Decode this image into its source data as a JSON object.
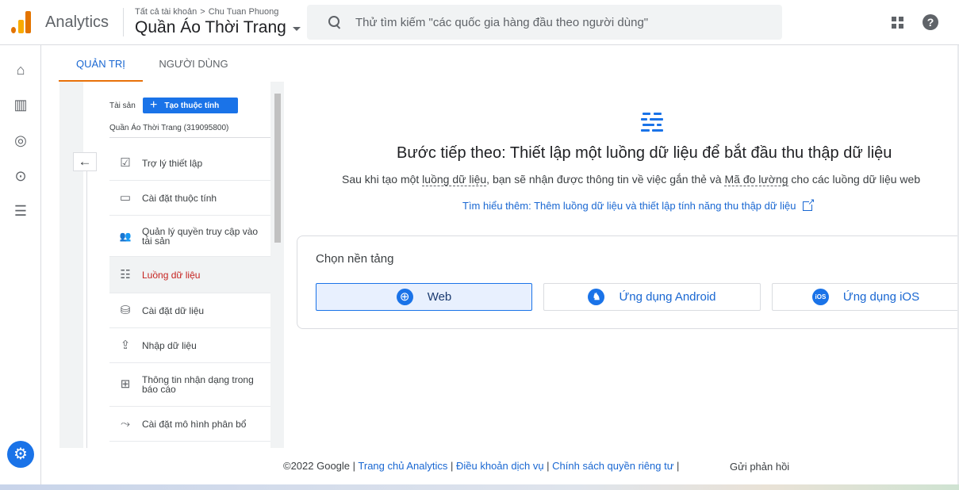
{
  "header": {
    "app_name": "Analytics",
    "breadcrumb": [
      "Tất cả tài khoản",
      "Chu Tuan Phuong"
    ],
    "breadcrumb_separator": ">",
    "property": "Quần Áo Thời Trang",
    "search_placeholder": "Thử tìm kiếm \"các quốc gia hàng đầu theo người dùng\"",
    "apps_icon": "apps-grid-icon",
    "help_icon": "help-icon",
    "help_glyph": "?"
  },
  "rail": {
    "items": [
      {
        "name": "home-icon",
        "glyph": "⌂"
      },
      {
        "name": "reports-icon",
        "glyph": "▥"
      },
      {
        "name": "explore-icon",
        "glyph": "◎"
      },
      {
        "name": "advertising-icon",
        "glyph": "⊙"
      },
      {
        "name": "configure-icon",
        "glyph": "☰"
      }
    ],
    "settings_glyph": "⚙"
  },
  "tabs": {
    "admin": "QUẢN TRỊ",
    "users": "NGƯỜI DÙNG"
  },
  "admin_panel": {
    "asset_label": "Tài sản",
    "create_button": "Tạo thuộc tính",
    "create_plus": "+",
    "back_glyph": "←",
    "property_name": "Quần Áo Thời Trang (319095800)",
    "menu": [
      {
        "label": "Trợ lý thiết lập",
        "glyph": "☑",
        "icon": "setup-assistant-icon"
      },
      {
        "label": "Cài đặt thuộc tính",
        "glyph": "▭",
        "icon": "property-settings-icon"
      },
      {
        "label": "Quản lý quyền truy cập vào tài sản",
        "glyph": "👥",
        "icon": "access-management-icon"
      },
      {
        "label": "Luồng dữ liệu",
        "glyph": "☷",
        "icon": "data-streams-icon",
        "active": true
      },
      {
        "label": "Cài đặt dữ liệu",
        "glyph": "⛁",
        "icon": "data-settings-icon"
      },
      {
        "label": "Nhập dữ liệu",
        "glyph": "⇪",
        "icon": "data-import-icon"
      },
      {
        "label": "Thông tin nhận dạng trong báo cáo",
        "glyph": "⊞",
        "icon": "reporting-identity-icon"
      },
      {
        "label": "Cài đặt mô hình phân bổ",
        "glyph": "⤳",
        "icon": "attribution-settings-icon"
      }
    ]
  },
  "main": {
    "heading": "Bước tiếp theo: Thiết lập một luồng dữ liệu để bắt đầu thu thập dữ liệu",
    "sub_prefix": "Sau khi tạo một ",
    "sub_term1": "luồng dữ liệu",
    "sub_middle": ", bạn sẽ nhận được thông tin về việc gắn thẻ và ",
    "sub_term2": "Mã đo lường",
    "sub_suffix": " cho các luồng dữ liệu web",
    "learn_more": "Tìm hiểu thêm: Thêm luồng dữ liệu và thiết lập tính năng thu thập dữ liệu",
    "platform_title": "Chọn nền tảng",
    "platforms": [
      {
        "label": "Web",
        "glyph": "⊕",
        "selected": true
      },
      {
        "label": "Ứng dụng Android",
        "glyph": "♞",
        "selected": false
      },
      {
        "label": "Ứng dụng iOS",
        "glyph": "iOS",
        "selected": false
      }
    ]
  },
  "footer": {
    "copyright": "©2022 Google",
    "sep": " | ",
    "links": [
      "Trang chủ Analytics",
      "Điều khoản dịch vụ",
      "Chính sách quyền riêng tư"
    ],
    "trailing_sep": " |",
    "feedback": "Gửi phản hồi"
  }
}
